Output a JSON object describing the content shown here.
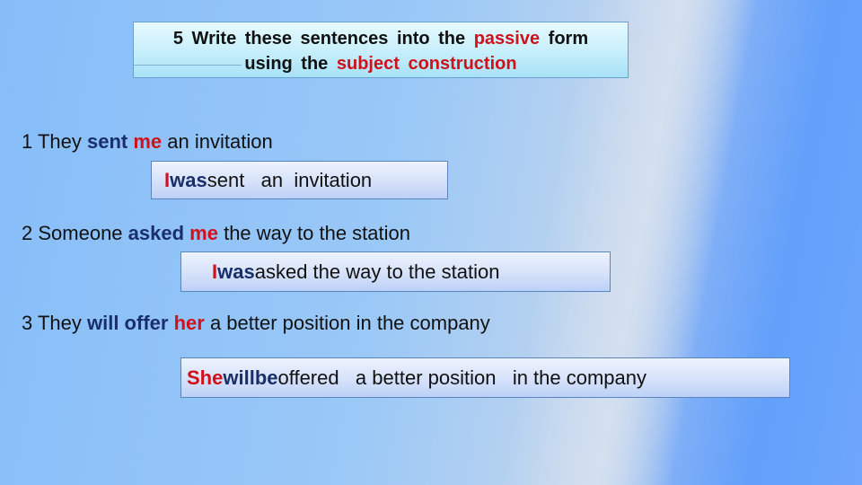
{
  "title": {
    "line1_prefix": "5  Write  these  sentences  into  the  ",
    "line1_highlight": "passive",
    "line1_suffix": "  form",
    "line2_prefix": "using  the  ",
    "line2_highlight": "subject  construction"
  },
  "exercises": [
    {
      "number": "1",
      "active": {
        "subject": " They ",
        "verb": "sent",
        "object": "me",
        "rest": " an invitation"
      },
      "passive": {
        "subject": "I",
        "aux": "was",
        "rest": "sent   an  invitation"
      }
    },
    {
      "number": "2",
      "active": {
        "subject": " Someone ",
        "verb": "asked",
        "object": "me",
        "rest": " the way to the station"
      },
      "passive": {
        "subject": "I",
        "aux": "was",
        "rest": "asked the way to the station"
      }
    },
    {
      "number": "3",
      "active": {
        "subject": " They ",
        "verb": "will offer",
        "object": "her",
        "rest": " a better position in the company"
      },
      "passive": {
        "subject": "She",
        "aux": "will",
        "aux2": "be",
        "rest": "offered   a better position   in the company"
      }
    }
  ],
  "colors": {
    "highlight_red": "#d0101a",
    "verb_navy": "#1a2f6a"
  }
}
